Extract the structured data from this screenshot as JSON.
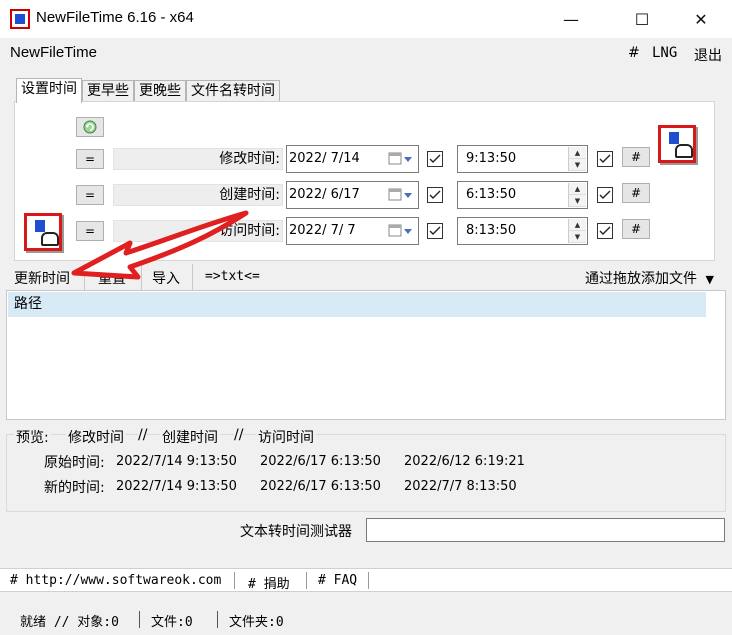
{
  "window": {
    "title": "NewFileTime 6.16 - x64",
    "controls": {
      "minimize": "—",
      "maximize": "☐",
      "close": "✕"
    }
  },
  "menubar": {
    "app_name": "NewFileTime",
    "items": [
      "#",
      "LNG",
      "退出"
    ]
  },
  "tabs": [
    "设置时间",
    "更早些",
    "更晚些",
    "文件名转时间"
  ],
  "fields": [
    {
      "label": "修改时间:",
      "date": "2022/  7/14",
      "time": "9:13:50",
      "date_checked": true,
      "time_checked": true,
      "equal": "=",
      "hash": "#"
    },
    {
      "label": "创建时间:",
      "date": "2022/  6/17",
      "time": "6:13:50",
      "date_checked": true,
      "time_checked": true,
      "equal": "=",
      "hash": "#"
    },
    {
      "label": "访问时间:",
      "date": "2022/  7/  7",
      "time": "8:13:50",
      "date_checked": true,
      "time_checked": true,
      "equal": "=",
      "hash": "#"
    }
  ],
  "toolbar": {
    "update": "更新时间",
    "reset": "重置",
    "import": "导入",
    "txt": "=>txt<=",
    "drag_add": "通过拖放添加文件"
  },
  "list": {
    "header": "路径"
  },
  "preview": {
    "legend_preview": "预览:",
    "col_modified": "修改时间",
    "sep": "//",
    "col_created": "创建时间",
    "col_accessed": "访问时间",
    "rows": [
      {
        "label": "原始时间:",
        "values": [
          "2022/7/14 9:13:50",
          "2022/6/17 6:13:50",
          "2022/6/12 6:19:21"
        ]
      },
      {
        "label": "新的时间:",
        "values": [
          "2022/7/14 9:13:50",
          "2022/6/17 6:13:50",
          "2022/7/7 8:13:50"
        ]
      }
    ]
  },
  "tester": {
    "label": "文本转时间测试器",
    "value": ""
  },
  "footer_links": [
    "# http://www.softwareok.com",
    "# 捐助",
    "# FAQ"
  ],
  "status": {
    "ready": "就绪 // 对象:0",
    "files": "文件:0",
    "folders": "文件夹:0"
  },
  "colors": {
    "selection": "#d9eaf7",
    "arrow": "#e02020",
    "logo_red": "#d91919",
    "logo_blue": "#1f4fd1"
  }
}
